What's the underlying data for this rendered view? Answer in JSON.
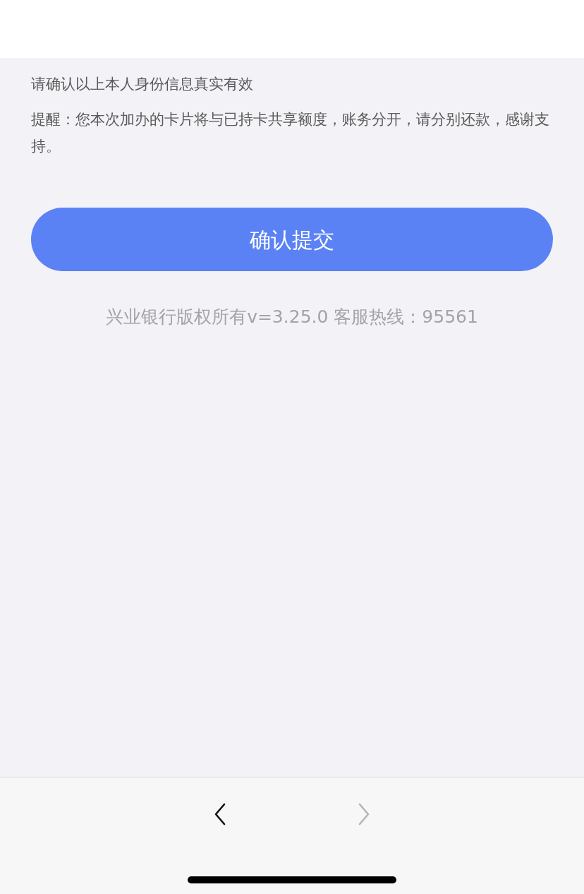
{
  "notices": [
    "请确认以上本人身份信息真实有效",
    "提醒：您本次加办的卡片将与已持卡共享额度，账务分开，请分别还款，感谢支持。"
  ],
  "submit_button": {
    "label": "确认提交"
  },
  "footer": "兴业银行版权所有v=3.25.0 客服热线：95561",
  "toolbar": [
    {
      "kind": "back",
      "disabled": false
    },
    {
      "kind": "forward",
      "disabled": true
    }
  ]
}
